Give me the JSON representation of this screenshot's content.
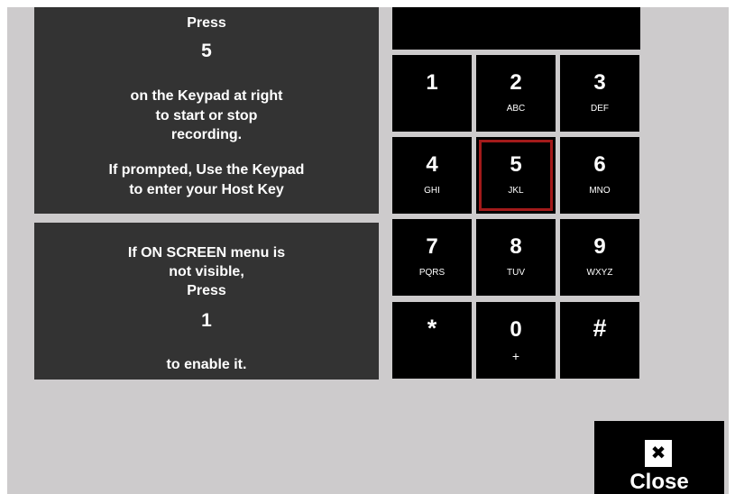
{
  "instructions_top": {
    "line1": "Press",
    "key": "5",
    "line2": "on the Keypad at right",
    "line3": "to start or stop",
    "line4": "recording.",
    "line5": "If prompted, Use the Keypad",
    "line6": "to enter your Host Key"
  },
  "instructions_bottom": {
    "line1": "If ON SCREEN menu is",
    "line2": "not visible,",
    "line3": "Press",
    "key": "1",
    "line4": "to enable it."
  },
  "keypad": {
    "keys": [
      {
        "digit": "1",
        "letters": ""
      },
      {
        "digit": "2",
        "letters": "ABC"
      },
      {
        "digit": "3",
        "letters": "DEF"
      },
      {
        "digit": "4",
        "letters": "GHI"
      },
      {
        "digit": "5",
        "letters": "JKL"
      },
      {
        "digit": "6",
        "letters": "MNO"
      },
      {
        "digit": "7",
        "letters": "PQRS"
      },
      {
        "digit": "8",
        "letters": "TUV"
      },
      {
        "digit": "9",
        "letters": "WXYZ"
      },
      {
        "digit": "*",
        "letters": ""
      },
      {
        "digit": "0",
        "letters": "+"
      },
      {
        "digit": "#",
        "letters": ""
      }
    ],
    "highlighted_key": "5",
    "highlight_color": "#a31a1a"
  },
  "close_button": {
    "icon": "close-icon",
    "icon_glyph": "✖",
    "label": "Close"
  },
  "colors": {
    "background": "#cdcbcc",
    "panel": "#333333",
    "key": "#000000"
  }
}
